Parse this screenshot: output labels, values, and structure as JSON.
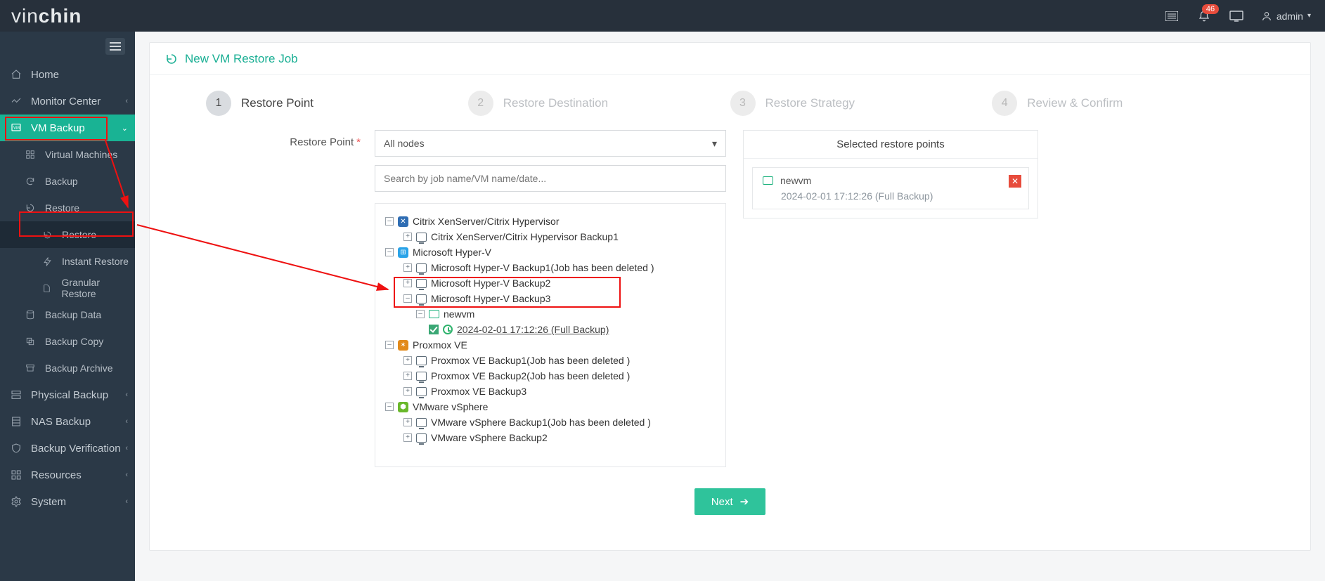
{
  "brand": {
    "light": "vin",
    "bold": "chin"
  },
  "topbar": {
    "notif_count": "46",
    "user": "admin"
  },
  "sidebar": {
    "home": "Home",
    "monitor": "Monitor Center",
    "vm_backup": "VM Backup",
    "virtual_machines": "Virtual Machines",
    "backup": "Backup",
    "restore": "Restore",
    "restore_sub": "Restore",
    "instant_restore": "Instant Restore",
    "granular_restore": "Granular Restore",
    "backup_data": "Backup Data",
    "backup_copy": "Backup Copy",
    "backup_archive": "Backup Archive",
    "physical_backup": "Physical Backup",
    "nas_backup": "NAS Backup",
    "backup_verification": "Backup Verification",
    "resources": "Resources",
    "system": "System"
  },
  "page": {
    "title": "New VM Restore Job",
    "steps": {
      "s1": "Restore Point",
      "s2": "Restore Destination",
      "s3": "Restore Strategy",
      "s4": "Review & Confirm"
    },
    "restore_point_label": "Restore Point",
    "all_nodes": "All nodes",
    "search_placeholder": "Search by job name/VM name/date...",
    "selected_title": "Selected restore points",
    "next": "Next"
  },
  "tree": {
    "citrix": "Citrix XenServer/Citrix Hypervisor",
    "citrix_b1": "Citrix XenServer/Citrix Hypervisor Backup1",
    "hv": "Microsoft Hyper-V",
    "hv_b1": "Microsoft Hyper-V Backup1(Job has been deleted )",
    "hv_b2": "Microsoft Hyper-V Backup2",
    "hv_b3": "Microsoft Hyper-V Backup3",
    "newvm": "newvm",
    "rp": "2024-02-01 17:12:26 (Full  Backup)",
    "px": "Proxmox VE",
    "px_b1": "Proxmox VE Backup1(Job has been deleted )",
    "px_b2": "Proxmox VE Backup2(Job has been deleted )",
    "px_b3": "Proxmox VE Backup3",
    "vw": "VMware vSphere",
    "vw_b1": "VMware vSphere Backup1(Job has been deleted )",
    "vw_b2": "VMware vSphere Backup2"
  },
  "selected": {
    "vm": "newvm",
    "detail": "2024-02-01 17:12:26 (Full Backup)"
  }
}
